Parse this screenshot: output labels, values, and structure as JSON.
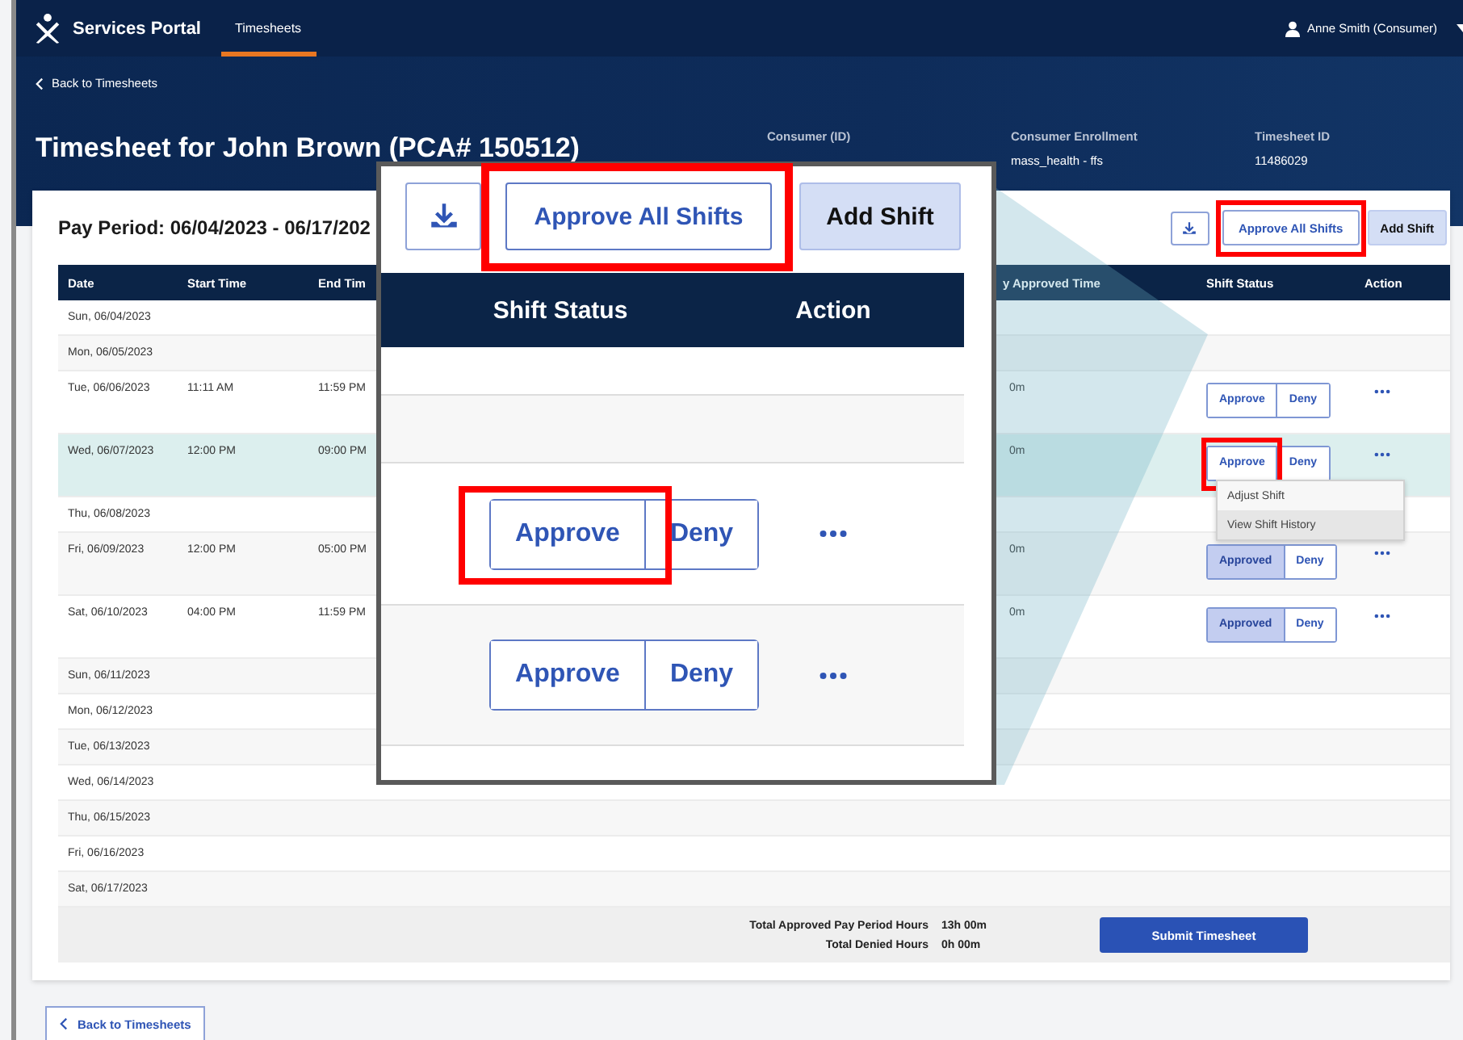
{
  "nav": {
    "brand": "Services Portal",
    "tabs": [
      {
        "label": "Timesheets",
        "selected": true
      }
    ],
    "user": "Anne Smith (Consumer)"
  },
  "back_link": "Back to Timesheets",
  "title": "Timesheet for John Brown (PCA# 150512)",
  "info": [
    {
      "label": "Consumer (ID)"
    },
    {
      "label": "Consumer Enrollment",
      "value": "mass_health - ffs"
    },
    {
      "label": "Timesheet ID",
      "value": "11486029"
    }
  ],
  "pay_period": "Pay Period: 06/04/2023 - 06/17/202",
  "toolbar": {
    "approve_all": "Approve All Shifts",
    "approve_all_annotated": true,
    "add_shift": "Add Shift"
  },
  "table": {
    "columns": [
      "Date",
      "Start Time",
      "End Tim",
      "y Approved Time",
      "Shift Status",
      "Action"
    ],
    "rows": [
      {
        "date": "Sun, 06/04/2023",
        "selected": false
      },
      {
        "date": "Mon, 06/05/2023",
        "selected": false
      },
      {
        "date": "Tue, 06/06/2023",
        "selected": false,
        "shift": {
          "start": "11:11 AM",
          "end": "11:59 PM",
          "approved_time": "0m",
          "approve": "Approve",
          "approved": false,
          "annotated": false,
          "deny": "Deny"
        }
      },
      {
        "date": "Wed, 06/07/2023",
        "selected": true,
        "shift": {
          "start": "12:00 PM",
          "end": "09:00 PM",
          "approved_time": "0m",
          "approve": "Approve",
          "approved": false,
          "annotated": true,
          "deny": "Deny"
        },
        "menu": [
          {
            "label": "Adjust Shift",
            "selected": false
          },
          {
            "label": "View Shift History",
            "selected": true
          }
        ]
      },
      {
        "date": "Thu, 06/08/2023",
        "selected": false
      },
      {
        "date": "Fri, 06/09/2023",
        "selected": false,
        "shift": {
          "start": "12:00 PM",
          "end": "05:00 PM",
          "approved_time": "0m",
          "approve": "Approved",
          "approved": true,
          "annotated": false,
          "deny": "Deny"
        }
      },
      {
        "date": "Sat, 06/10/2023",
        "selected": false,
        "shift": {
          "start": "04:00 PM",
          "end": "11:59 PM",
          "approved_time": "0m",
          "approve": "Approved",
          "approved": true,
          "annotated": false,
          "deny": "Deny"
        }
      },
      {
        "date": "Sun, 06/11/2023",
        "selected": false
      },
      {
        "date": "Mon, 06/12/2023",
        "selected": false
      },
      {
        "date": "Tue, 06/13/2023",
        "selected": false
      },
      {
        "date": "Wed, 06/14/2023",
        "selected": false
      },
      {
        "date": "Thu, 06/15/2023",
        "selected": false
      },
      {
        "date": "Fri, 06/16/2023",
        "selected": false
      },
      {
        "date": "Sat, 06/17/2023",
        "selected": false
      }
    ]
  },
  "totals": [
    {
      "label": "Total Approved Pay Period Hours",
      "value": "13h 00m"
    },
    {
      "label": "Total Denied Hours",
      "value": "0h 00m"
    }
  ],
  "submit": "Submit Timesheet",
  "footer_back": "Back to Timesheets",
  "magnifier": {
    "toolbar": {
      "approve_all": "Approve All Shifts",
      "approve_all_annotated": true,
      "add_shift": "Add Shift"
    },
    "columns": [
      "Shift Status",
      "Action"
    ],
    "rows": [
      {
        "kind": "empty"
      },
      {
        "kind": "empty"
      },
      {
        "kind": "shift",
        "approve": "Approve",
        "deny": "Deny",
        "approved": false,
        "annotated": true
      },
      {
        "kind": "shift",
        "approve": "Approve",
        "deny": "Deny",
        "approved": false,
        "annotated": false
      }
    ]
  }
}
